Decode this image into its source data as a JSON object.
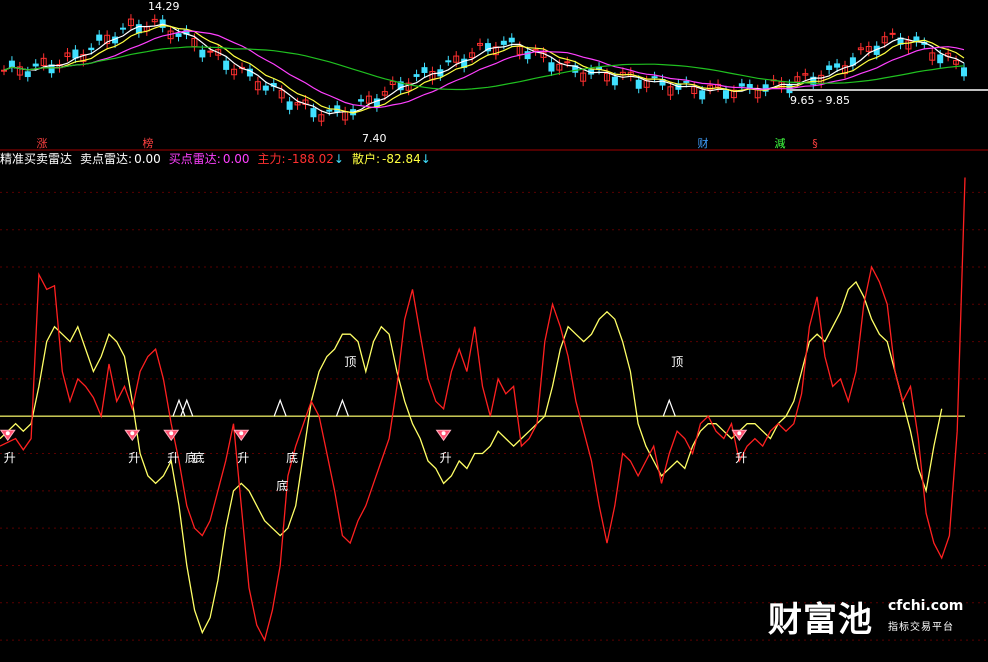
{
  "header": {
    "indicator_name": "精准买卖雷达",
    "sell_label": "卖点雷达:",
    "sell_value": "0.00",
    "buy_label": "买点雷达:",
    "buy_value": "0.00",
    "main_label": "主力:",
    "main_value": "-188.02",
    "main_arrow": "↓",
    "retail_label": "散户:",
    "retail_value": "-82.84",
    "retail_arrow": "↓"
  },
  "colors": {
    "background": "#000000",
    "main_line": "#ff2020",
    "retail_line": "#ffff66",
    "zero_line": "#e0e060",
    "grid": "#5a0000",
    "up_candle": "#ff3030",
    "down_candle": "#40e0ff",
    "ma5": "#ffffff",
    "ma10": "#ffff40",
    "ma20": "#ff40ff",
    "ma60": "#20c020",
    "divider": "#a00000"
  },
  "price_panel": {
    "high_label": "14.29",
    "low_label": "7.40",
    "range_label": "9.65 - 9.85",
    "event_markers": [
      {
        "text": "涨",
        "color": "#ff4040"
      },
      {
        "text": "榜",
        "color": "#ff4040"
      },
      {
        "text": "财",
        "color": "#40a0ff"
      },
      {
        "text": "減",
        "color": "#40ff40"
      },
      {
        "text": "§",
        "color": "#ff4040"
      }
    ]
  },
  "chart_data": {
    "type": "line",
    "title": "精准买卖雷达",
    "series": [
      {
        "name": "主力",
        "color": "#ff2020",
        "last": -188.02,
        "values": [
          -40,
          -35,
          -30,
          -45,
          -30,
          190,
          170,
          175,
          60,
          20,
          50,
          40,
          25,
          0,
          70,
          20,
          40,
          10,
          60,
          80,
          90,
          50,
          -10,
          -60,
          -120,
          -150,
          -160,
          -140,
          -100,
          -60,
          -10,
          -120,
          -230,
          -280,
          -300,
          -260,
          -200,
          -80,
          -40,
          -10,
          20,
          0,
          -50,
          -100,
          -160,
          -170,
          -140,
          -120,
          -90,
          -60,
          -30,
          40,
          130,
          170,
          110,
          50,
          20,
          10,
          60,
          90,
          60,
          120,
          40,
          0,
          50,
          30,
          40,
          -40,
          -30,
          -10,
          100,
          150,
          120,
          80,
          20,
          -20,
          -60,
          -120,
          -170,
          -120,
          -50,
          -60,
          -80,
          -60,
          -40,
          -90,
          -50,
          -20,
          -30,
          -50,
          -10,
          0,
          -20,
          -30,
          -10,
          -60,
          -40,
          -30,
          -40,
          -20,
          -10,
          -20,
          -10,
          30,
          120,
          160,
          80,
          40,
          50,
          20,
          60,
          150,
          200,
          180,
          150,
          60,
          20,
          40,
          -30,
          -130,
          -170,
          -190,
          -160,
          -20,
          320
        ]
      },
      {
        "name": "散户",
        "color": "#ffff66",
        "last": -82.84,
        "values": [
          -30,
          -20,
          -10,
          -20,
          -10,
          40,
          100,
          120,
          110,
          100,
          120,
          90,
          60,
          80,
          110,
          100,
          80,
          20,
          -50,
          -80,
          -90,
          -80,
          -60,
          -120,
          -200,
          -260,
          -290,
          -270,
          -220,
          -150,
          -100,
          -90,
          -100,
          -120,
          -140,
          -150,
          -160,
          -150,
          -120,
          -50,
          20,
          60,
          80,
          90,
          110,
          110,
          100,
          60,
          100,
          120,
          110,
          60,
          20,
          -10,
          -30,
          -60,
          -70,
          -90,
          -80,
          -60,
          -70,
          -50,
          -50,
          -40,
          -20,
          -30,
          -40,
          -30,
          -20,
          -10,
          0,
          40,
          90,
          120,
          110,
          100,
          110,
          130,
          140,
          130,
          100,
          60,
          -10,
          -40,
          -60,
          -80,
          -70,
          -60,
          -70,
          -40,
          -20,
          -10,
          -10,
          -20,
          -30,
          -20,
          -10,
          -10,
          -20,
          -30,
          -10,
          0,
          20,
          60,
          100,
          110,
          100,
          120,
          140,
          170,
          180,
          160,
          130,
          110,
          100,
          60,
          20,
          -20,
          -70,
          -100,
          -40,
          10
        ]
      }
    ],
    "ylim": [
      -320,
      330
    ],
    "grid": true,
    "annotations": [
      {
        "text": "升",
        "x": 1
      },
      {
        "text": "升",
        "x": 17
      },
      {
        "text": "升",
        "x": 22
      },
      {
        "text": "底",
        "x": 23
      },
      {
        "text": "底",
        "x": 24
      },
      {
        "text": "升",
        "x": 31
      },
      {
        "text": "底",
        "x": 36
      },
      {
        "text": "底",
        "x": 36
      },
      {
        "text": "顶",
        "x": 44
      },
      {
        "text": "升",
        "x": 57
      },
      {
        "text": "顶",
        "x": 86
      },
      {
        "text": "升",
        "x": 95
      }
    ]
  },
  "watermark": {
    "brand": "财富池",
    "url": "cfchi.com",
    "tagline": "指标交易平台"
  }
}
